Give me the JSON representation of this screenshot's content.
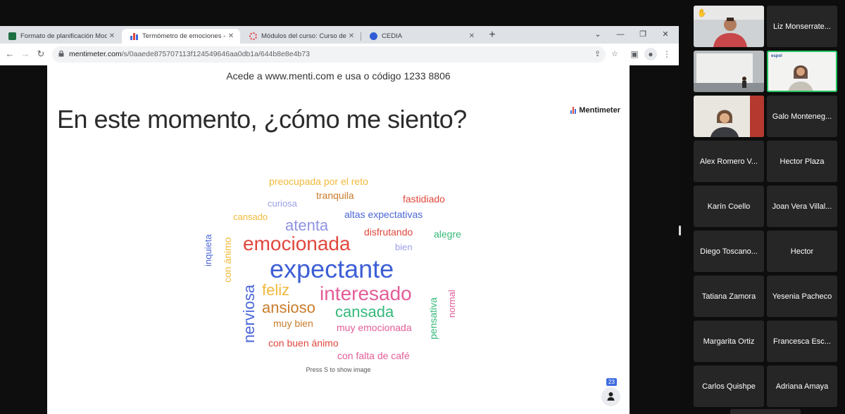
{
  "browser": {
    "tabs": [
      {
        "title": "Formato de planificación Modelo",
        "fav_color": "#1d7044"
      },
      {
        "title": "Termómetro de emociones - Men",
        "fav_color": "#3e6de0"
      },
      {
        "title": "Módulos del curso: Curso de Apr",
        "fav_color": "#e43a3a"
      },
      {
        "title": "CEDIA",
        "fav_color": "#2f5bd6"
      }
    ],
    "url_host": "mentimeter.com",
    "url_path": "/s/0aaede875707113f124549646aa0db1a/644b8e8e4b73"
  },
  "slide": {
    "join_text": "Acede a www.menti.com e usa o código 1233 8806",
    "question": "En este momento, ¿cómo me siento?",
    "logo": "Mentimeter",
    "hint": "Press S to show image",
    "participants": "23"
  },
  "wordcloud": [
    {
      "text": "preocupada por el reto",
      "color": "#f0b93a"
    },
    {
      "text": "tranquila",
      "color": "#c97b2a"
    },
    {
      "text": "fastidiado",
      "color": "#e0473d"
    },
    {
      "text": "curiosa",
      "color": "#9b9fe6"
    },
    {
      "text": "cansado",
      "color": "#f0b93a"
    },
    {
      "text": "altas expectativas",
      "color": "#4a67d8"
    },
    {
      "text": "atenta",
      "color": "#8f93e2"
    },
    {
      "text": "disfrutando",
      "color": "#e0473d"
    },
    {
      "text": "alegre",
      "color": "#34b97a"
    },
    {
      "text": "emocionada",
      "color": "#e0473d"
    },
    {
      "text": "bien",
      "color": "#9b9fe6"
    },
    {
      "text": "expectante",
      "color": "#3d5fd6"
    },
    {
      "text": "feliz",
      "color": "#f0b93a"
    },
    {
      "text": "interesado",
      "color": "#e35d98"
    },
    {
      "text": "ansioso",
      "color": "#c97b2a"
    },
    {
      "text": "cansada",
      "color": "#34b97a"
    },
    {
      "text": "muy bien",
      "color": "#c97b2a"
    },
    {
      "text": "muy emocionada",
      "color": "#e35d98"
    },
    {
      "text": "con buen ánimo",
      "color": "#e0473d"
    },
    {
      "text": "con falta de café",
      "color": "#e35d98"
    },
    {
      "text": "inquieta",
      "color": "#4a67d8"
    },
    {
      "text": "con ánimo",
      "color": "#f0b93a"
    },
    {
      "text": "nerviosa",
      "color": "#4a67d8"
    },
    {
      "text": "pensativa",
      "color": "#34b97a"
    },
    {
      "text": "normal",
      "color": "#e35d98"
    }
  ],
  "participants": [
    {
      "name": ""
    },
    {
      "name": "Liz Monserrate..."
    },
    {
      "name": ""
    },
    {
      "name": ""
    },
    {
      "name": ""
    },
    {
      "name": "Galo Monteneg..."
    },
    {
      "name": "Alex Romero V..."
    },
    {
      "name": "Hector Plaza"
    },
    {
      "name": "Karín Coello"
    },
    {
      "name": "Joan Vera Villal..."
    },
    {
      "name": "Diego Toscano..."
    },
    {
      "name": "Hector"
    },
    {
      "name": "Tatiana Zamora"
    },
    {
      "name": "Yesenia Pacheco"
    },
    {
      "name": "Margarita Ortiz"
    },
    {
      "name": "Francesca Esc..."
    },
    {
      "name": "Carlos Quishpe"
    },
    {
      "name": "Adriana Amaya"
    }
  ],
  "video_tile_labels": {
    "whiteboard_logo": "espol"
  }
}
